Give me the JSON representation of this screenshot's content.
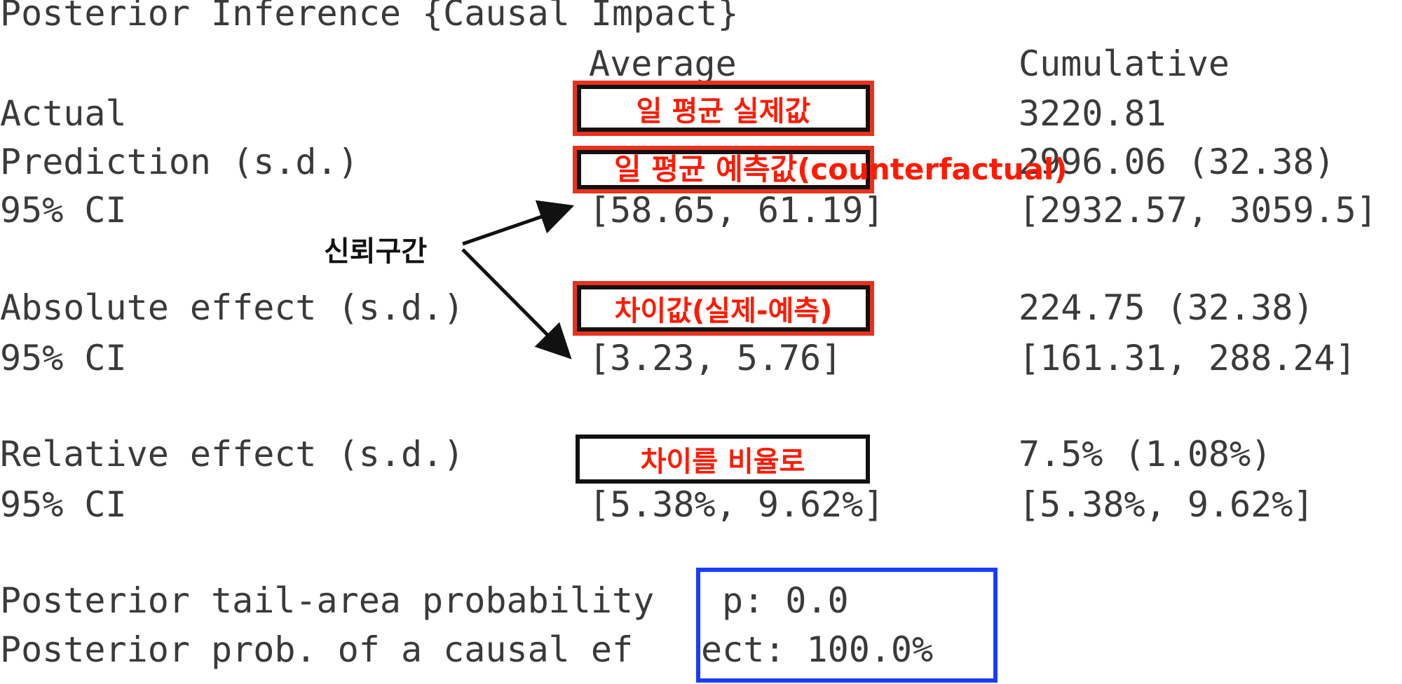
{
  "title": "Posterior Inference {Causal Impact}",
  "headers": {
    "average": "Average",
    "cumulative": "Cumulative"
  },
  "rows": {
    "actual": {
      "label": "Actual",
      "cumulative": "3220.81"
    },
    "prediction": {
      "label": "Prediction (s.d.)",
      "cumulative_visible": "2996.06 (32.38)"
    },
    "pred_ci": {
      "label": "95% CI",
      "average": "[58.65, 61.19]",
      "cumulative": "[2932.57, 3059.5]"
    },
    "absolute": {
      "label": "Absolute effect (s.d.)",
      "cumulative": "224.75 (32.38)"
    },
    "abs_ci": {
      "label": "95% CI",
      "average": "[3.23, 5.76]",
      "cumulative": "[161.31, 288.24]"
    },
    "relative": {
      "label": "Relative effect (s.d.)",
      "cumulative": "7.5% (1.08%)"
    },
    "rel_ci": {
      "label": "95% CI",
      "average": "[5.38%, 9.62%]",
      "cumulative": "[5.38%, 9.62%]"
    }
  },
  "posterior": {
    "tail_label": "Posterior tail-area probability",
    "tail_value": "p: 0.0",
    "prob_label": "Posterior prob. of a causal ef",
    "prob_value": "ect: 100.0%"
  },
  "annotations": {
    "actual_avg": "일 평균 실제값",
    "pred_avg": "일 평균 예측값(counterfactual)",
    "diff": "차이값(실제-예측)",
    "ratio": "차이를 비율로",
    "ci_callout": "신뢰구간"
  },
  "colors": {
    "annotation_text": "#ff1a00",
    "highlight_border": "#e8321e",
    "p_box": "#1a3cff"
  }
}
